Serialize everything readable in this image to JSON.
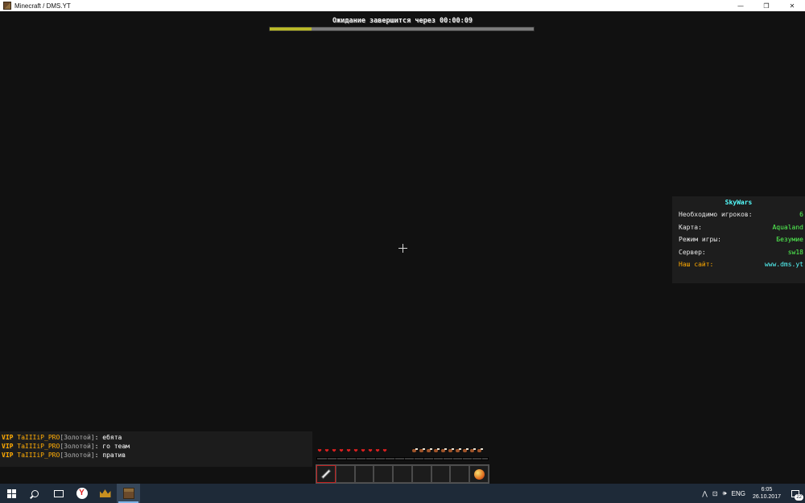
{
  "window": {
    "title": "Minecraft / DMS.YT",
    "minimize_glyph": "—",
    "restore_glyph": "❐",
    "close_glyph": "✕"
  },
  "bossbar": {
    "text": "Ожидание завершится через 00:00:09",
    "progress": 0.16,
    "color": "#b8b828"
  },
  "scoreboard": {
    "title": "SkyWars",
    "rows": [
      {
        "label": "Необходимо игроков:",
        "value": "6"
      },
      {
        "label": "Карта:",
        "value": "Aqualand"
      },
      {
        "label": "Режим игры:",
        "value": "Безумие"
      },
      {
        "label": "Сервер:",
        "value": "sw18"
      },
      {
        "label": "Наш сайт:",
        "value": "www.dms.yt"
      }
    ]
  },
  "chat": {
    "lines": [
      {
        "prefix": "VIP",
        "name": "TaIIIiP_PRO",
        "rank": "[Золотой]",
        "sep": ":",
        "message": "ебята"
      },
      {
        "prefix": "VIP",
        "name": "TaIIIiP_PRO",
        "rank": "[Золотой]",
        "sep": ":",
        "message": "го теам"
      },
      {
        "prefix": "VIP",
        "name": "TaIIIiP_PRO",
        "rank": "[Золотой]",
        "sep": ":",
        "message": "пратив"
      }
    ]
  },
  "hud": {
    "hearts": 10,
    "food": 10,
    "hotbar_selected": 0,
    "hotbar": [
      {
        "item": "sword-icon"
      },
      {
        "item": ""
      },
      {
        "item": ""
      },
      {
        "item": ""
      },
      {
        "item": ""
      },
      {
        "item": ""
      },
      {
        "item": ""
      },
      {
        "item": ""
      },
      {
        "item": "orb-icon"
      }
    ]
  },
  "taskbar": {
    "yandex_letter": "Y",
    "tray": {
      "up_arrow": "⋀",
      "network": "⊡",
      "volume": "🕪",
      "language": "ENG",
      "time": "6:05",
      "date": "26.10.2017",
      "notifications": "22"
    }
  }
}
